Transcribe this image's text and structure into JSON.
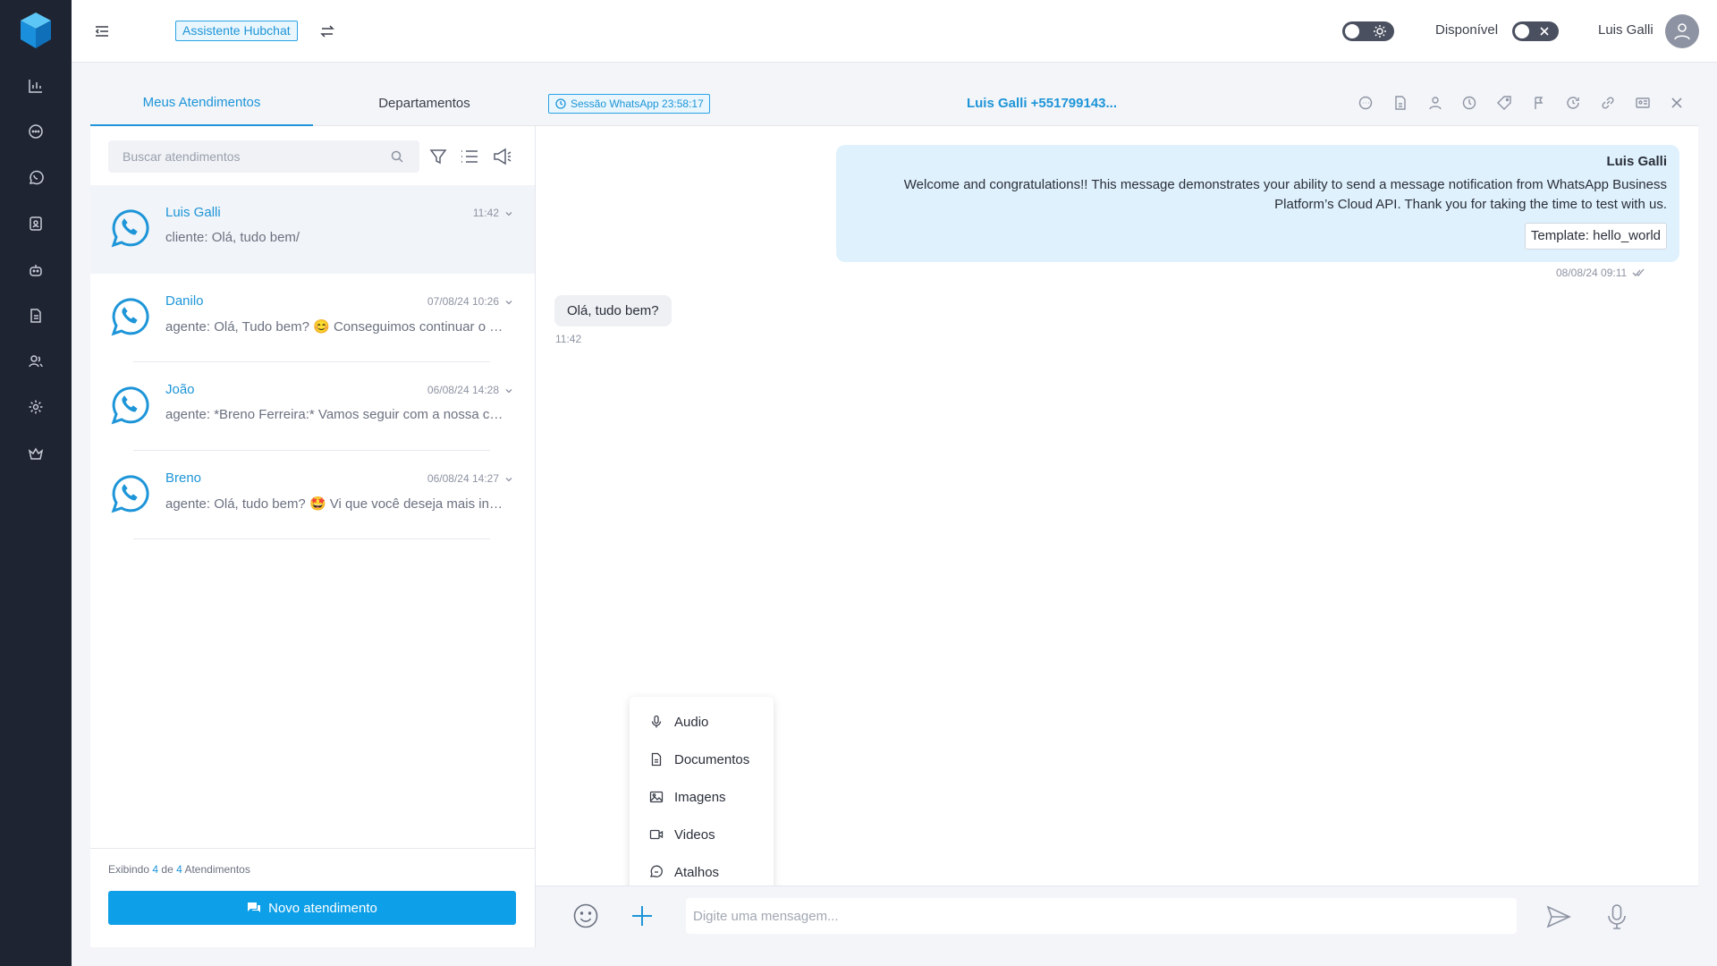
{
  "topbar": {
    "assistant_label": "Assistente Hubchat",
    "status_label": "Disponível",
    "user_name": "Luis Galli"
  },
  "tabs": [
    {
      "label": "Meus Atendimentos",
      "active": true
    },
    {
      "label": "Departamentos",
      "active": false
    }
  ],
  "search": {
    "placeholder": "Buscar atendimentos"
  },
  "conversations": [
    {
      "name": "Luis Galli",
      "time": "11:42",
      "preview": "cliente: Olá, tudo bem/",
      "active": true
    },
    {
      "name": "Danilo",
      "time": "07/08/24 10:26",
      "preview": "agente: Olá, Tudo bem? 😊 Conseguimos continuar o atendimento por aqui",
      "active": false
    },
    {
      "name": "João",
      "time": "06/08/24 14:28",
      "preview": "agente: *Breno Ferreira:* Vamos seguir com a nossa conversa",
      "active": false
    },
    {
      "name": "Breno",
      "time": "06/08/24 14:27",
      "preview": "agente: Olá, tudo bem? 🤩 Vi que você deseja mais informações",
      "active": false
    }
  ],
  "list_footer": {
    "prefix": "Exibindo",
    "shown": "4",
    "of": "de",
    "total": "4",
    "suffix": "Atendimentos",
    "new_button": "Novo atendimento"
  },
  "chat": {
    "session_label": "Sessão WhatsApp 23:58:17",
    "title": "Luis Galli +551799143...",
    "header_icons": [
      "chat-bubble-icon",
      "document-icon",
      "user-icon",
      "clock-history-icon",
      "tag-icon",
      "flag-icon",
      "schedule-icon",
      "link-icon",
      "id-card-icon",
      "close-icon"
    ],
    "messages": [
      {
        "direction": "out",
        "sender": "Luis Galli",
        "text": "Welcome and congratulations!! This message demonstrates your ability to send a message notification from WhatsApp Business Platform’s Cloud API. Thank you for taking the time to test with us.",
        "template": "Template: hello_world",
        "timestamp": "08/08/24 09:11"
      },
      {
        "direction": "in",
        "text": "Olá, tudo bem?",
        "timestamp": "11:42"
      }
    ]
  },
  "attach_menu": [
    {
      "label": "Audio",
      "icon": "mic-icon"
    },
    {
      "label": "Documentos",
      "icon": "document-icon"
    },
    {
      "label": "Imagens",
      "icon": "image-icon"
    },
    {
      "label": "Videos",
      "icon": "video-icon"
    },
    {
      "label": "Atalhos",
      "icon": "shortcut-icon"
    }
  ],
  "composer": {
    "placeholder": "Digite uma mensagem..."
  },
  "colors": {
    "accent": "#1d95d8",
    "primary_button": "#0d9fe8",
    "sidebar": "#1f2433",
    "outgoing_bubble": "#dff1fc"
  }
}
